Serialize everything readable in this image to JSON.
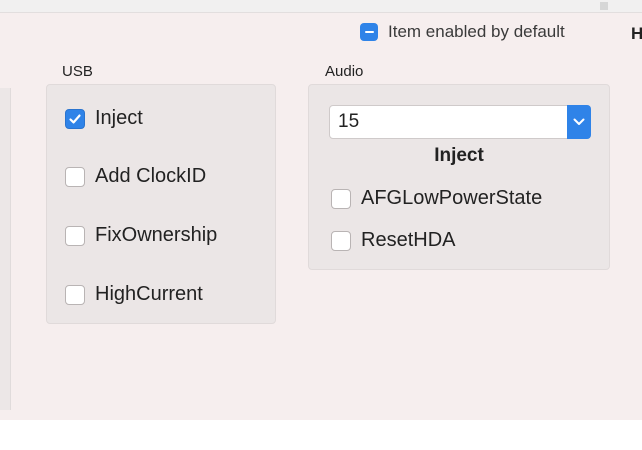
{
  "legend": {
    "label": "Item enabled by default",
    "cut_letter": "H"
  },
  "usb": {
    "title": "USB",
    "items": [
      {
        "label": "Inject",
        "checked": true
      },
      {
        "label": "Add ClockID",
        "checked": false
      },
      {
        "label": "FixOwnership",
        "checked": false
      },
      {
        "label": "HighCurrent",
        "checked": false
      }
    ]
  },
  "audio": {
    "title": "Audio",
    "select_value": "15",
    "select_caption": "Inject",
    "items": [
      {
        "label": "AFGLowPowerState",
        "checked": false
      },
      {
        "label": "ResetHDA",
        "checked": false
      }
    ]
  },
  "colors": {
    "accent": "#2f83e8",
    "panel": "#ebe6e6",
    "background": "#f6eeee"
  },
  "icons": {
    "legend": "mixed-state-checkbox-icon",
    "checked": "checkmark-icon",
    "select": "chevron-down-icon"
  }
}
